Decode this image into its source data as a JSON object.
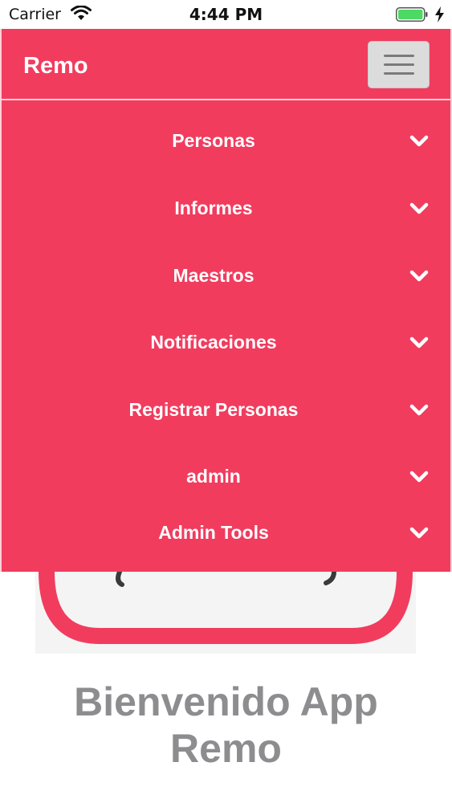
{
  "status_bar": {
    "carrier": "Carrier",
    "time": "4:44 PM",
    "battery_color": "#4cd964"
  },
  "navbar": {
    "brand": "Remo",
    "toggle_icon": "hamburger-icon",
    "accent_color": "#f13c5e",
    "items": [
      {
        "label": "Personas",
        "icon": "chevron-down-icon"
      },
      {
        "label": "Informes",
        "icon": "chevron-down-icon"
      },
      {
        "label": "Maestros",
        "icon": "chevron-down-icon"
      },
      {
        "label": "Notificaciones",
        "icon": "chevron-down-icon"
      },
      {
        "label": "Registrar Personas",
        "icon": "chevron-down-icon"
      },
      {
        "label": "admin",
        "icon": "chevron-down-icon"
      },
      {
        "label": "Admin Tools",
        "icon": "chevron-down-icon"
      }
    ]
  },
  "main": {
    "headline_line1": "Bienvenido App",
    "headline_line2": "Remo"
  }
}
